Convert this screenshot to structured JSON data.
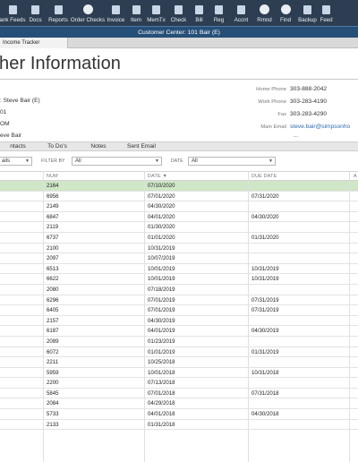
{
  "toolbar": {
    "items": [
      {
        "label": "ank Feeds",
        "icon": "bank-feeds-icon"
      },
      {
        "label": "Docs",
        "icon": "docs-icon"
      },
      {
        "label": "Reports",
        "icon": "reports-icon"
      },
      {
        "label": "Order Checks",
        "icon": "order-checks-icon"
      },
      {
        "label": "Invoice",
        "icon": "invoice-icon"
      },
      {
        "label": "Item",
        "icon": "item-icon"
      },
      {
        "label": "MemTx",
        "icon": "memtx-icon"
      },
      {
        "label": "Check",
        "icon": "check-icon"
      },
      {
        "label": "Bill",
        "icon": "bill-icon"
      },
      {
        "label": "Reg",
        "icon": "register-icon"
      },
      {
        "label": "Accnt",
        "icon": "accounts-icon"
      },
      {
        "label": "Rmnd",
        "icon": "reminders-icon"
      },
      {
        "label": "Find",
        "icon": "find-icon"
      },
      {
        "label": "Backup",
        "icon": "backup-icon"
      },
      {
        "label": "Feed",
        "icon": "feedback-icon"
      }
    ]
  },
  "window": {
    "title": "Customer Center: 101 Bair (E)"
  },
  "doc_tab": {
    "label": "Income Tracker"
  },
  "page_title": "her Information",
  "info_left": {
    "line1": ": Steve  Bair (E)",
    "line2": "01",
    "line3": "OM",
    "line4": "eve Bair"
  },
  "contact": {
    "home_phone_label": "Home Phone",
    "home_phone": "303-888-2042",
    "work_phone_label": "Work Phone",
    "work_phone": "303-283-4190",
    "fax_label": "Fax",
    "fax": "303-283-4290",
    "main_email_label": "Main Email",
    "main_email": "steve.bair@simpsonho",
    "more": "..."
  },
  "subtabs": [
    "ntacts",
    "To Do's",
    "Notes",
    "Sent Email"
  ],
  "filters": {
    "show_value": "ails",
    "filter_by_label": "FILTER BY",
    "filter_by_value": "All",
    "date_label": "DATE",
    "date_value": "All"
  },
  "table": {
    "headers": {
      "num": "NUM",
      "date": "DATE ▼",
      "due_date": "DUE DATE",
      "extra": "A"
    },
    "rows": [
      {
        "num": "2164",
        "date": "07/10/2020",
        "due": ""
      },
      {
        "num": "6956",
        "date": "07/01/2020",
        "due": "07/31/2020"
      },
      {
        "num": "2149",
        "date": "04/30/2020",
        "due": ""
      },
      {
        "num": "6847",
        "date": "04/01/2020",
        "due": "04/30/2020"
      },
      {
        "num": "2119",
        "date": "01/30/2020",
        "due": ""
      },
      {
        "num": "6737",
        "date": "01/01/2020",
        "due": "01/31/2020"
      },
      {
        "num": "2100",
        "date": "10/31/2019",
        "due": ""
      },
      {
        "num": "2097",
        "date": "10/07/2019",
        "due": ""
      },
      {
        "num": "6513",
        "date": "10/01/2019",
        "due": "10/31/2019"
      },
      {
        "num": "6622",
        "date": "10/01/2019",
        "due": "10/31/2019"
      },
      {
        "num": "2080",
        "date": "07/18/2019",
        "due": ""
      },
      {
        "num": "6296",
        "date": "07/01/2019",
        "due": "07/31/2019"
      },
      {
        "num": "6405",
        "date": "07/01/2019",
        "due": "07/31/2019"
      },
      {
        "num": "2157",
        "date": "04/30/2019",
        "due": ""
      },
      {
        "num": "6187",
        "date": "04/01/2019",
        "due": "04/30/2019"
      },
      {
        "num": "2089",
        "date": "01/23/2019",
        "due": ""
      },
      {
        "num": "6072",
        "date": "01/01/2019",
        "due": "01/31/2019"
      },
      {
        "num": "2211",
        "date": "10/25/2018",
        "due": ""
      },
      {
        "num": "5959",
        "date": "10/01/2018",
        "due": "10/31/2018"
      },
      {
        "num": "2200",
        "date": "07/13/2018",
        "due": ""
      },
      {
        "num": "5845",
        "date": "07/01/2018",
        "due": "07/31/2018"
      },
      {
        "num": "2084",
        "date": "04/29/2018",
        "due": ""
      },
      {
        "num": "5733",
        "date": "04/01/2018",
        "due": "04/30/2018"
      },
      {
        "num": "2133",
        "date": "01/31/2018",
        "due": ""
      }
    ]
  }
}
